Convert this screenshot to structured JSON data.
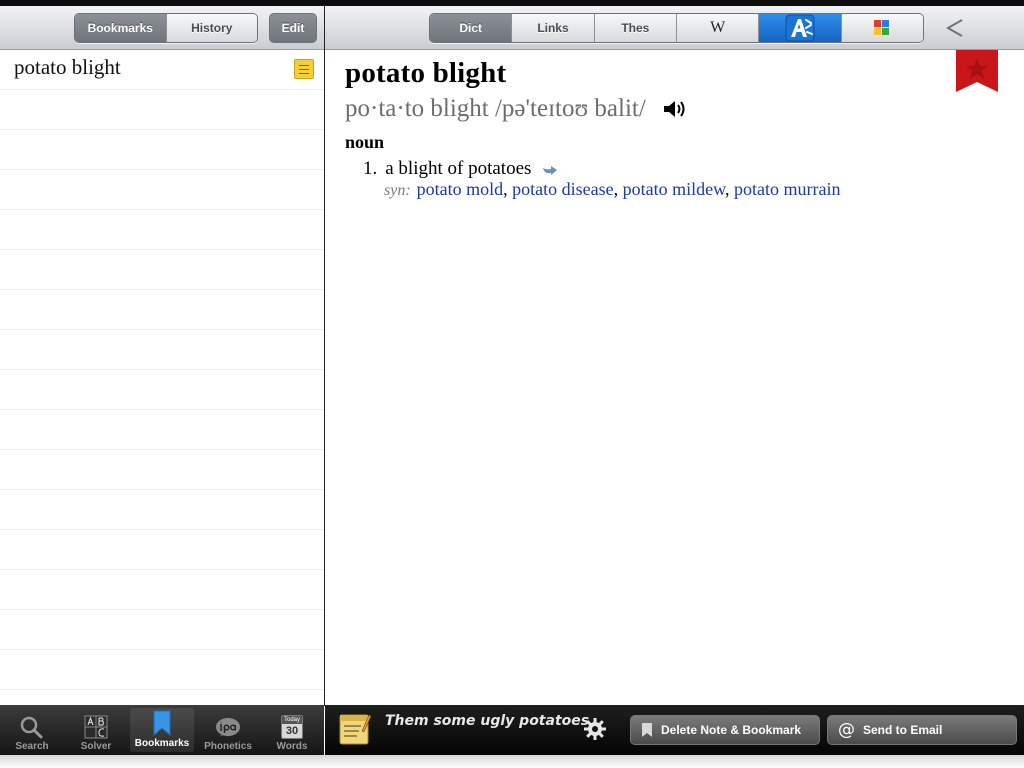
{
  "left_toolbar": {
    "segments": [
      "Bookmarks",
      "History"
    ],
    "edit_label": "Edit"
  },
  "right_toolbar": {
    "segments": [
      "Dict",
      "Links",
      "Thes"
    ],
    "wikipedia_label": "W"
  },
  "list": {
    "items": [
      {
        "label": "potato blight"
      }
    ]
  },
  "entry": {
    "headword": "potato blight",
    "pronunciation": "po·ta·to blight /pə'teɪtoʊ balit/",
    "part_of_speech": "noun",
    "sense_number": "1.",
    "definition": "a blight of potatoes",
    "syn_label": "syn:",
    "synonyms": [
      "potato mold",
      "potato disease",
      "potato mildew",
      "potato murrain"
    ]
  },
  "bottom_tabs": [
    "Search",
    "Solver",
    "Bookmarks",
    "Phonetics",
    "Words"
  ],
  "words_tab_icon": {
    "top": "Today",
    "day": "30"
  },
  "note": {
    "text": "Them some ugly potatoes",
    "delete_label": "Delete Note & Bookmark",
    "email_label": "Send to Email"
  }
}
